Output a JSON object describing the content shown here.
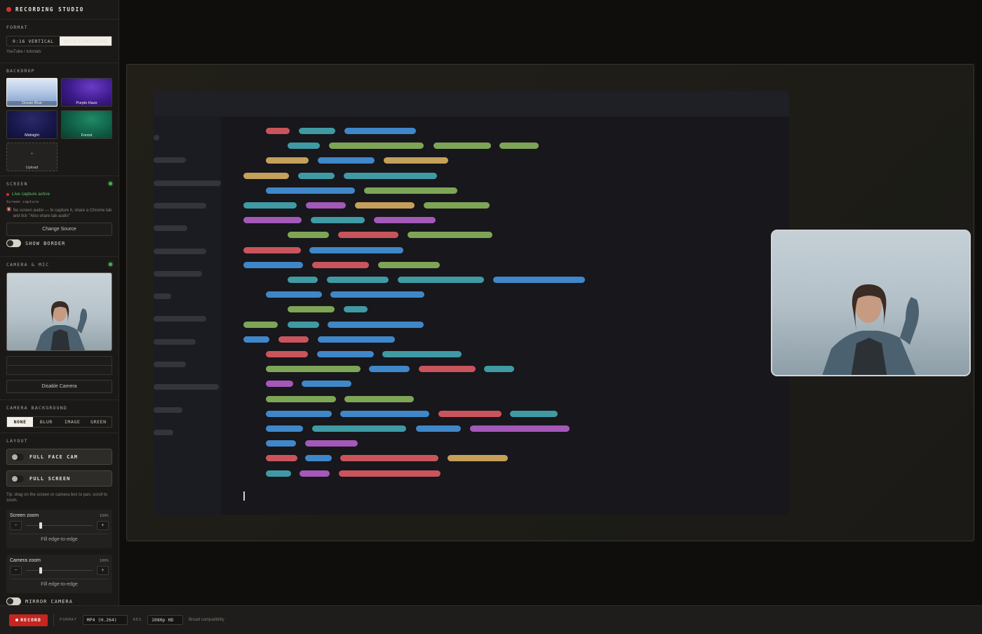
{
  "app": {
    "title": "RECORDING STUDIO"
  },
  "format": {
    "title": "FORMAT",
    "options": [
      "9:16 VERTICAL",
      "16:9 LANDSCAPE"
    ],
    "selected": "16:9 LANDSCAPE",
    "hint": "YouTube / tutorials"
  },
  "backdrop": {
    "title": "BACKDROP",
    "tiles": [
      {
        "label": "Ocean Blue",
        "selected": true
      },
      {
        "label": "Purple Haze",
        "selected": false
      },
      {
        "label": "Midnight",
        "selected": false
      },
      {
        "label": "Forest",
        "selected": false
      },
      {
        "label": "Upload",
        "selected": false
      }
    ],
    "upload_icon": "+"
  },
  "screen": {
    "title": "SCREEN",
    "status": "Live capture active",
    "source_label": "Screen capture",
    "audio_note": "No screen audio — to capture it, share a Chrome tab and tick \"Also share tab audio\"",
    "audio_icon": "muted-speaker-icon",
    "change_source_label": "Change Source",
    "show_border_label": "SHOW BORDER",
    "show_border": true,
    "status_color": "#4caf50"
  },
  "camera": {
    "title": "CAMERA & MIC",
    "disable_label": "Disable Camera"
  },
  "camera_background": {
    "title": "CAMERA BACKGROUND",
    "options": [
      "NONE",
      "BLUR",
      "IMAGE",
      "GREEN"
    ],
    "selected": "NONE"
  },
  "layout": {
    "title": "LAYOUT",
    "full_face_cam": "FULL FACE CAM",
    "full_screen": "FULL SCREEN",
    "tip": "Tip: drag on the screen or camera box to pan, scroll to zoom."
  },
  "screen_zoom": {
    "label": "Screen zoom",
    "value": "100%",
    "level": 0.2,
    "minus": "−",
    "plus": "+",
    "fill_label": "Fill edge-to-edge"
  },
  "camera_zoom": {
    "label": "Camera zoom",
    "value": "100%",
    "level": 0.2,
    "minus": "−",
    "plus": "+",
    "fill_label": "Fill edge-to-edge"
  },
  "mirror": {
    "label": "MIRROR CAMERA",
    "on": true
  },
  "bottombar": {
    "record_label": "RECORD",
    "format_label": "FORMAT",
    "format_value": "MP4 (H.264)",
    "res_label": "RES",
    "res_value": "1080p HD",
    "compat": "Broad compatibility"
  },
  "colors": {
    "record": "#c6261f",
    "red": "#c9545c",
    "teal": "#3f9aa4",
    "blue": "#3f87c8",
    "green": "#7ea556",
    "yellow": "#c5a05a",
    "purple": "#a458b8"
  }
}
